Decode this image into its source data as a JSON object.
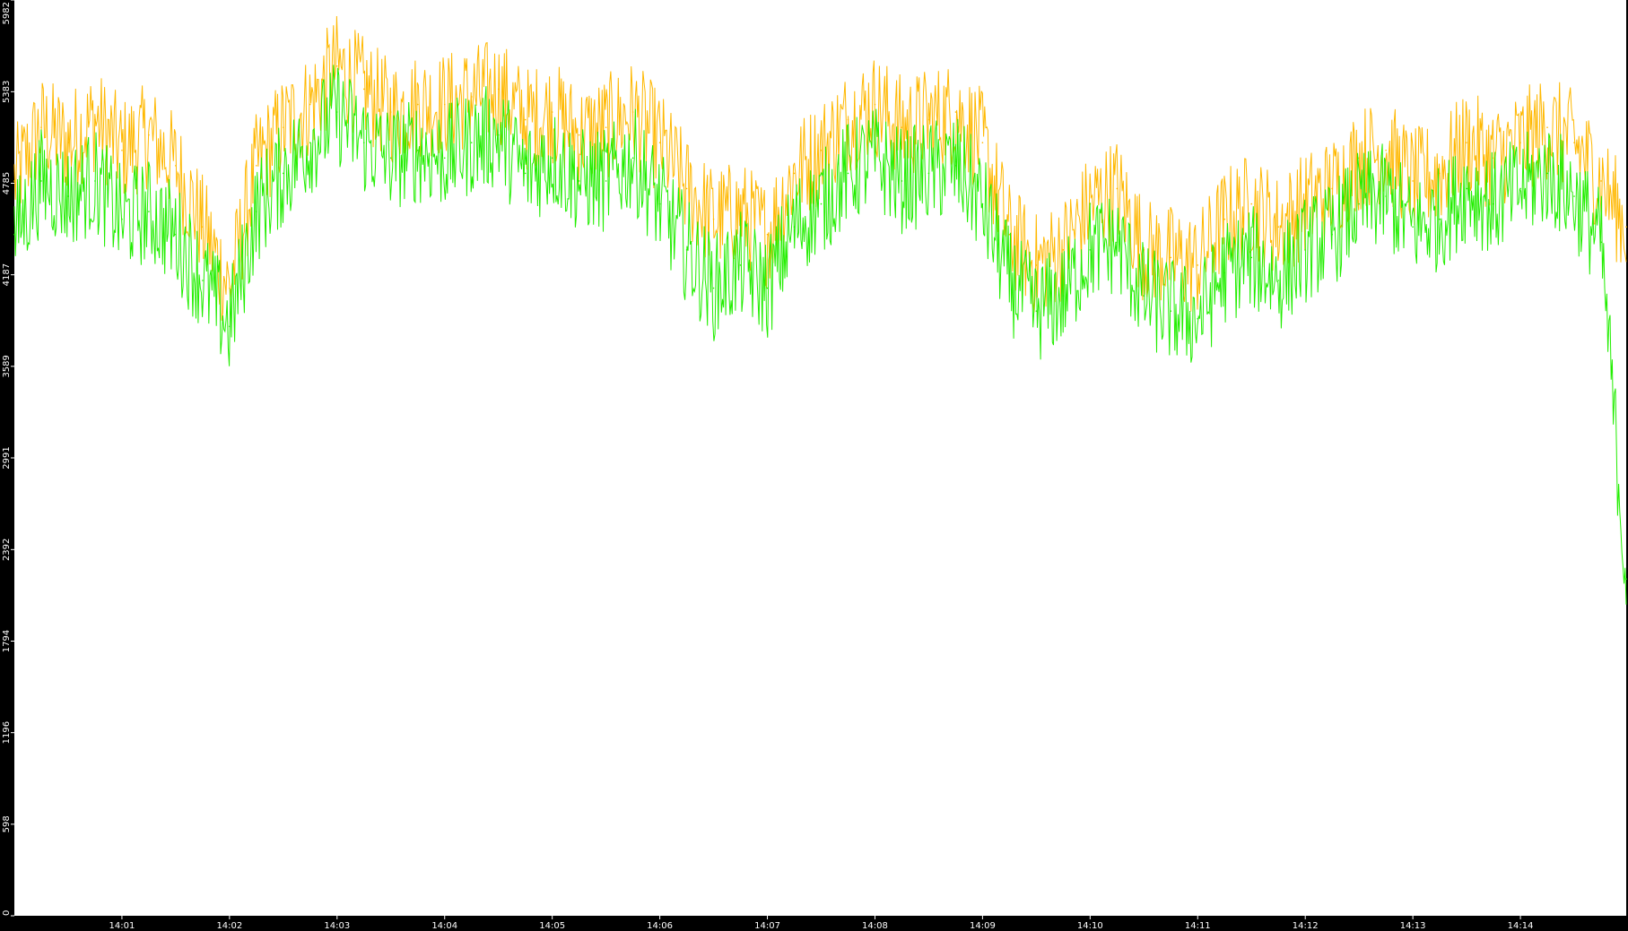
{
  "chart_data": {
    "type": "line",
    "title": "",
    "xlabel": "",
    "ylabel": "",
    "background_color": "#ffffff",
    "frame_color": "#000000",
    "ylim": [
      0,
      5982
    ],
    "yticks": [
      0,
      598,
      1196,
      1794,
      2392,
      2991,
      3589,
      4187,
      4785,
      5383,
      5982
    ],
    "ytick_labels": [
      "0",
      "598",
      "1196",
      "1794",
      "2392",
      "2991",
      "3589",
      "4187",
      "4785",
      "5383",
      "5982"
    ],
    "xlim": [
      "14:00:00",
      "14:14:59"
    ],
    "xtick_labels": [
      "14:01",
      "14:02",
      "14:03",
      "14:04",
      "14:05",
      "14:06",
      "14:07",
      "14:08",
      "14:09",
      "14:10",
      "14:11",
      "14:12",
      "14:13",
      "14:14"
    ],
    "grid": false,
    "legend": "none",
    "series": [
      {
        "color": "#ffb800",
        "x": [
          "14:00:00",
          "14:00:15",
          "14:00:30",
          "14:00:45",
          "14:01:00",
          "14:01:15",
          "14:01:30",
          "14:01:45",
          "14:02:00",
          "14:02:15",
          "14:02:30",
          "14:02:45",
          "14:03:00",
          "14:03:15",
          "14:03:30",
          "14:03:45",
          "14:04:00",
          "14:04:15",
          "14:04:30",
          "14:04:45",
          "14:05:00",
          "14:05:15",
          "14:05:30",
          "14:05:45",
          "14:06:00",
          "14:06:15",
          "14:06:30",
          "14:06:45",
          "14:07:00",
          "14:07:15",
          "14:07:30",
          "14:07:45",
          "14:08:00",
          "14:08:15",
          "14:08:30",
          "14:08:45",
          "14:09:00",
          "14:09:15",
          "14:09:30",
          "14:09:45",
          "14:10:00",
          "14:10:15",
          "14:10:30",
          "14:10:45",
          "14:11:00",
          "14:11:15",
          "14:11:30",
          "14:11:45",
          "14:12:00",
          "14:12:15",
          "14:12:30",
          "14:12:45",
          "14:13:00",
          "14:13:15",
          "14:13:30",
          "14:13:45",
          "14:14:00",
          "14:14:15",
          "14:14:30",
          "14:14:45",
          "14:14:59"
        ],
        "values": [
          4800,
          5150,
          5050,
          5200,
          5000,
          5100,
          4900,
          4500,
          4100,
          4900,
          5150,
          5300,
          5550,
          5400,
          5250,
          5300,
          5300,
          5350,
          5400,
          5200,
          5250,
          5100,
          5150,
          5250,
          5050,
          4750,
          4550,
          4600,
          4450,
          4850,
          5000,
          5200,
          5300,
          5150,
          5200,
          5250,
          5050,
          4450,
          4250,
          4350,
          4650,
          4750,
          4350,
          4300,
          4250,
          4550,
          4650,
          4500,
          4650,
          4750,
          4950,
          5000,
          4800,
          4850,
          5050,
          4950,
          5050,
          5150,
          5050,
          4800,
          4500
        ]
      },
      {
        "color": "#22ee00",
        "x": [
          "14:00:00",
          "14:00:15",
          "14:00:30",
          "14:00:45",
          "14:01:00",
          "14:01:15",
          "14:01:30",
          "14:01:45",
          "14:02:00",
          "14:02:15",
          "14:02:30",
          "14:02:45",
          "14:03:00",
          "14:03:15",
          "14:03:30",
          "14:03:45",
          "14:04:00",
          "14:04:15",
          "14:04:30",
          "14:04:45",
          "14:05:00",
          "14:05:15",
          "14:05:30",
          "14:05:45",
          "14:06:00",
          "14:06:15",
          "14:06:30",
          "14:06:45",
          "14:07:00",
          "14:07:15",
          "14:07:30",
          "14:07:45",
          "14:08:00",
          "14:08:15",
          "14:08:30",
          "14:08:45",
          "14:09:00",
          "14:09:15",
          "14:09:30",
          "14:09:45",
          "14:10:00",
          "14:10:15",
          "14:10:30",
          "14:10:45",
          "14:11:00",
          "14:11:15",
          "14:11:30",
          "14:11:45",
          "14:12:00",
          "14:12:15",
          "14:12:30",
          "14:12:45",
          "14:13:00",
          "14:13:15",
          "14:13:30",
          "14:13:45",
          "14:14:00",
          "14:14:15",
          "14:14:30",
          "14:14:45",
          "14:14:59"
        ],
        "values": [
          4450,
          4800,
          4700,
          4800,
          4550,
          4600,
          4450,
          4150,
          3850,
          4600,
          4850,
          5050,
          5250,
          5050,
          4950,
          5000,
          4950,
          5050,
          5100,
          4850,
          4950,
          4800,
          4800,
          4950,
          4650,
          4350,
          4100,
          4250,
          4100,
          4500,
          4650,
          4850,
          4950,
          4800,
          4850,
          4900,
          4650,
          4150,
          3950,
          4050,
          4350,
          4400,
          4050,
          3950,
          3900,
          4200,
          4300,
          4150,
          4350,
          4450,
          4650,
          4700,
          4500,
          4550,
          4750,
          4650,
          4750,
          4850,
          4700,
          4400,
          2200
        ]
      }
    ]
  }
}
